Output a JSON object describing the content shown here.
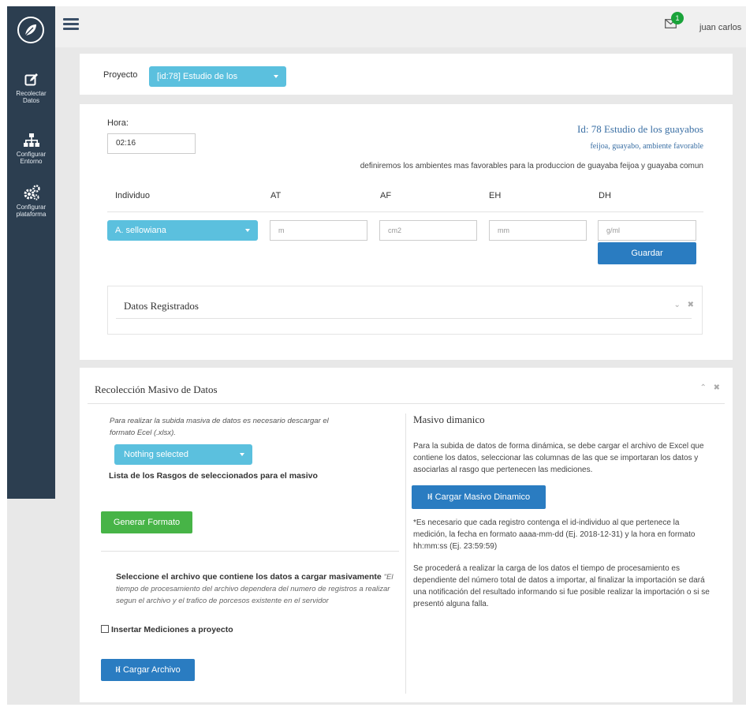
{
  "sidebar": {
    "items": [
      {
        "label_1": "Recolectar",
        "label_2": "Datos",
        "icon": "edit-icon"
      },
      {
        "label_1": "Configurar",
        "label_2": "Entorno",
        "icon": "sitemap-icon"
      },
      {
        "label_1": "Configurar",
        "label_2": "plataforma",
        "icon": "gears-icon"
      }
    ]
  },
  "topbar": {
    "notification_count": "1",
    "user_name": "juan carlos"
  },
  "proyecto": {
    "label": "Proyecto",
    "selected": "[id:78] Estudio de los"
  },
  "registro": {
    "hora_label": "Hora:",
    "hora_value": "02:16",
    "id_title": "Id: 78 Estudio de los guayabos",
    "id_tags": "feijoa, guayabo, ambiente favorable",
    "id_description": "definiremos los ambientes mas favorables para la produccion de guayaba feijoa y guayaba comun",
    "columns": [
      "Individuo",
      "AT",
      "AF",
      "EH",
      "DH"
    ],
    "individuo_selected": "A. sellowiana",
    "placeholders": {
      "at": "m",
      "af": "cm2",
      "eh": "mm",
      "dh": "g/ml"
    },
    "save_label": "Guardar",
    "datos_title": "Datos Registrados"
  },
  "masivo": {
    "title": "Recolección Masivo de Datos",
    "note_1": "Para realizar la subida masiva de datos es necesario descargar el",
    "note_2": "formato Ecel (.xlsx).",
    "rasgos_selected": "Nothing selected",
    "rasgos_label": "Lista de los Rasgos de seleccionados para el masivo",
    "generar_label": "Generar Formato",
    "select_file_bold": "Seleccione el archivo que contiene los datos a cargar masivamente",
    "select_file_note": "\"El tiempo de procesamiento del archivo dependera del numero de registros a realizar segun el archivo y el trafico de porcesos existente en el servidor",
    "checkbox_label": "Insertar Mediciones a proyecto",
    "cargar_archivo_label": "Cargar Archivo",
    "dinamico_title": "Masivo dimanico",
    "dinamico_text_1": "Para la subida de datos de forma dinámica, se debe cargar el archivo de Excel que contiene los datos, seleccionar las columnas de las que se importaran los datos y asociarlas al rasgo que pertenecen las mediciones.",
    "cargar_masivo_label": "Cargar Masivo Dinamico",
    "dinamico_text_2": "*Es necesario que cada registro contenga el id-individuo al que pertenece la medición, la fecha en formato aaaa-mm-dd (Ej. 2018-12-31) y la hora en formato hh:mm:ss (Ej. 23:59:59)",
    "dinamico_text_3": "Se procederá a realizar la carga de los datos el tiempo de procesamiento es dependiente del número total de datos a importar, al finalizar la importación se dará una notificación del resultado informando si fue posible realizar la importación o si se presentó alguna falla."
  }
}
